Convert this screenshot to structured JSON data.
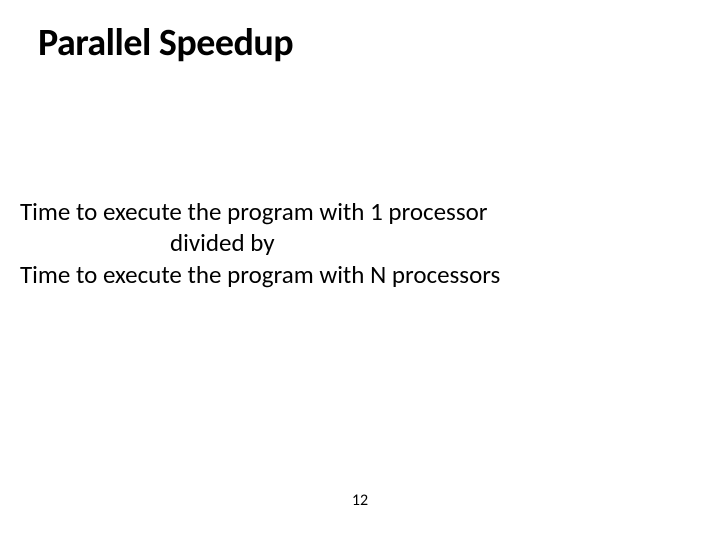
{
  "title": "Parallel Speedup",
  "body": {
    "line1": "Time to execute the program with 1 processor",
    "line2": "divided by",
    "line3": "Time to execute the program with N processors"
  },
  "page_number": "12"
}
